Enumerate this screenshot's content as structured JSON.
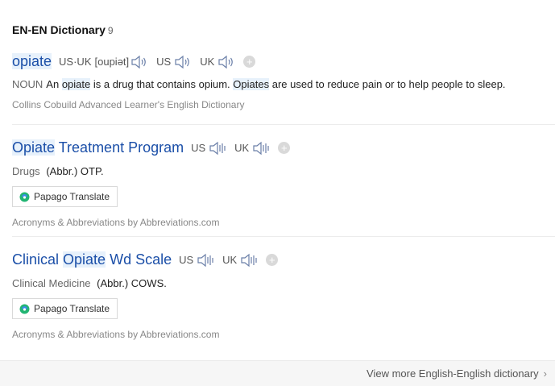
{
  "section": {
    "title": "EN-EN Dictionary",
    "count": "9"
  },
  "entries": [
    {
      "word": "opiate",
      "pron": {
        "us_uk_label": "US·UK",
        "ipa": "[oupiət]",
        "us_label": "US",
        "uk_label": "UK"
      },
      "def": {
        "pos": "NOUN",
        "t1": "An",
        "h1": "opiate",
        "t2": " is a drug that contains opium.",
        "h2": "Opiates",
        "t3": " are used to reduce pain or to help people to sleep."
      },
      "source": "Collins Cobuild Advanced Learner's English Dictionary"
    },
    {
      "word_hl": "Opiate",
      "word_rest": " Treatment Program",
      "us_label": "US",
      "uk_label": "UK",
      "category": "Drugs",
      "abbr": "(Abbr.) OTP.",
      "papago": "Papago Translate",
      "source": "Acronyms & Abbreviations by Abbreviations.com"
    },
    {
      "word_pre": "Clinical ",
      "word_hl": "Opiate",
      "word_rest": " Wd Scale",
      "us_label": "US",
      "uk_label": "UK",
      "category": "Clinical Medicine",
      "abbr": "(Abbr.) COWS.",
      "papago": "Papago Translate",
      "source": "Acronyms & Abbreviations by Abbreviations.com"
    }
  ],
  "footer": {
    "more_label": "View more English-English dictionary"
  },
  "icons": {
    "speaker": "speaker-icon",
    "plus": "plus-icon",
    "papago": "papago-icon",
    "chevron": "chevron-right-icon"
  },
  "colors": {
    "headword": "#1b4fa8",
    "highlight": "#e7f1fb"
  }
}
